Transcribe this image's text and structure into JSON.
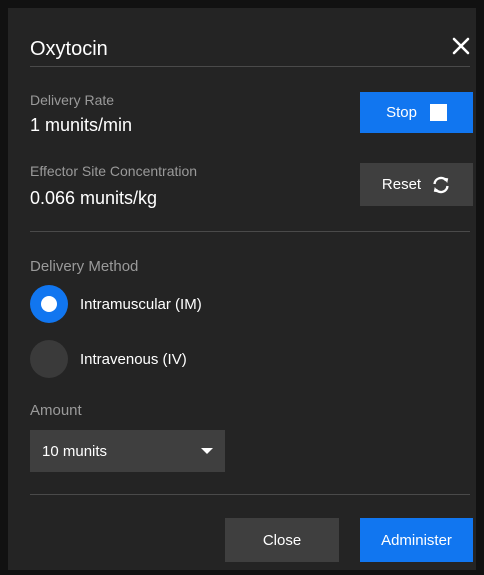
{
  "dialog": {
    "title": "Oxytocin"
  },
  "delivery_rate": {
    "label": "Delivery Rate",
    "value": "1 munits/min"
  },
  "effector_site": {
    "label": "Effector Site Concentration",
    "value": "0.066 munits/kg"
  },
  "buttons": {
    "stop_label": "Stop",
    "reset_label": "Reset",
    "close_label": "Close",
    "administer_label": "Administer"
  },
  "delivery_method": {
    "label": "Delivery Method",
    "options": [
      {
        "label": "Intramuscular (IM)",
        "selected": true
      },
      {
        "label": "Intravenous (IV)",
        "selected": false
      }
    ]
  },
  "amount": {
    "label": "Amount",
    "selected": "10 munits"
  },
  "colors": {
    "primary": "#1176f0",
    "panel": "#242424",
    "secondary_button": "#3f3f3f",
    "muted_text": "#9a9a9a"
  },
  "icons": {
    "close": "close-icon",
    "stop": "stop-icon",
    "reset": "refresh-icon",
    "dropdown": "chevron-down-icon"
  }
}
